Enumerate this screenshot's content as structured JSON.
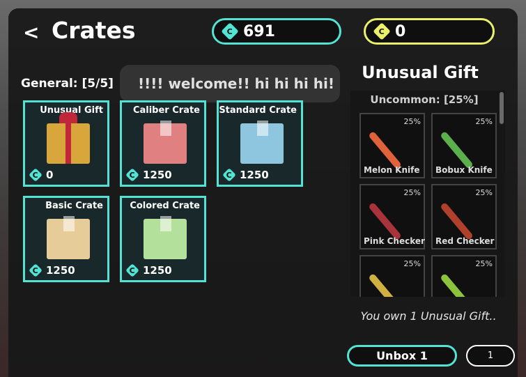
{
  "header": {
    "back_label": "<",
    "title": "Crates",
    "currency_cyan": "691",
    "currency_yellow": "0",
    "gem_glyph": "C"
  },
  "chat_message": "!!!! welcome!! hi hi hi hi!",
  "section": {
    "label": "General: [5/5]"
  },
  "crates": [
    {
      "name": "Unusual Gift",
      "price": "0",
      "color": "#d8a63a"
    },
    {
      "name": "Caliber Crate",
      "price": "1250",
      "color": "#e08080"
    },
    {
      "name": "Standard Crate",
      "price": "1250",
      "color": "#8ec6e0"
    },
    {
      "name": "Basic Crate",
      "price": "1250",
      "color": "#e6cc98"
    },
    {
      "name": "Colored Crate",
      "price": "1250",
      "color": "#b3e09b"
    }
  ],
  "detail": {
    "title": "Unusual Gift",
    "rarity_header": "Uncommon: [25%]",
    "items": [
      {
        "name": "Melon Knife",
        "chance": "25%",
        "color": "#e0623a"
      },
      {
        "name": "Bobux Knife",
        "chance": "25%",
        "color": "#5cb04c"
      },
      {
        "name": "Pink Checker",
        "chance": "25%",
        "color": "#a8333a"
      },
      {
        "name": "Red Checker",
        "chance": "25%",
        "color": "#b0402c"
      },
      {
        "name": "",
        "chance": "25%",
        "color": "#d0b040"
      },
      {
        "name": "",
        "chance": "25%",
        "color": "#8cc33c"
      }
    ],
    "own_text": "You own 1 Unusual Gift..",
    "unbox_label": "Unbox 1",
    "quantity": "1"
  }
}
